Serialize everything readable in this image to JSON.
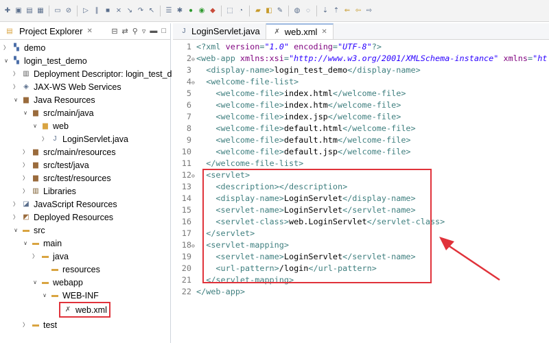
{
  "explorer": {
    "title": "Project Explorer",
    "items": [
      {
        "label": "demo",
        "icon": "project-icon",
        "expanded": false
      },
      {
        "label": "login_test_demo",
        "icon": "project-icon",
        "expanded": true
      },
      {
        "label": "Deployment Descriptor: login_test_d",
        "icon": "descriptor-icon"
      },
      {
        "label": "JAX-WS Web Services",
        "icon": "webservices-icon"
      },
      {
        "label": "Java Resources",
        "icon": "java-resources-icon",
        "expanded": true
      },
      {
        "label": "src/main/java",
        "icon": "source-folder-icon",
        "expanded": true
      },
      {
        "label": "web",
        "icon": "package-icon",
        "expanded": true
      },
      {
        "label": "LoginServlet.java",
        "icon": "java-file-icon"
      },
      {
        "label": "src/main/resources",
        "icon": "source-folder-icon"
      },
      {
        "label": "src/test/java",
        "icon": "source-folder-icon"
      },
      {
        "label": "src/test/resources",
        "icon": "source-folder-icon"
      },
      {
        "label": "Libraries",
        "icon": "library-icon"
      },
      {
        "label": "JavaScript Resources",
        "icon": "javascript-icon"
      },
      {
        "label": "Deployed Resources",
        "icon": "deployed-icon"
      },
      {
        "label": "src",
        "icon": "folder-icon",
        "expanded": true
      },
      {
        "label": "main",
        "icon": "folder-icon",
        "expanded": true
      },
      {
        "label": "java",
        "icon": "folder-icon"
      },
      {
        "label": "resources",
        "icon": "folder-icon"
      },
      {
        "label": "webapp",
        "icon": "folder-icon",
        "expanded": true
      },
      {
        "label": "WEB-INF",
        "icon": "folder-icon",
        "expanded": true
      },
      {
        "label": "web.xml",
        "icon": "xml-file-icon",
        "selected": true
      },
      {
        "label": "test",
        "icon": "folder-icon"
      }
    ]
  },
  "editor": {
    "tabs": [
      {
        "label": "LoginServlet.java",
        "active": false
      },
      {
        "label": "web.xml",
        "active": true
      }
    ],
    "lines": [
      {
        "n": "1",
        "fold": "",
        "code": "<?xml version=\"1.0\" encoding=\"UTF-8\"?>"
      },
      {
        "n": "2",
        "fold": "⊖",
        "code": "<web-app xmlns:xsi=\"http://www.w3.org/2001/XMLSchema-instance\" xmlns=\"ht"
      },
      {
        "n": "3",
        "fold": "",
        "code": "  <display-name>login_test_demo</display-name>"
      },
      {
        "n": "4",
        "fold": "⊖",
        "code": "  <welcome-file-list>"
      },
      {
        "n": "5",
        "fold": "",
        "code": "    <welcome-file>index.html</welcome-file>"
      },
      {
        "n": "6",
        "fold": "",
        "code": "    <welcome-file>index.htm</welcome-file>"
      },
      {
        "n": "7",
        "fold": "",
        "code": "    <welcome-file>index.jsp</welcome-file>"
      },
      {
        "n": "8",
        "fold": "",
        "code": "    <welcome-file>default.html</welcome-file>"
      },
      {
        "n": "9",
        "fold": "",
        "code": "    <welcome-file>default.htm</welcome-file>"
      },
      {
        "n": "10",
        "fold": "",
        "code": "    <welcome-file>default.jsp</welcome-file>"
      },
      {
        "n": "11",
        "fold": "",
        "code": "  </welcome-file-list>"
      },
      {
        "n": "12",
        "fold": "⊖",
        "code": "  <servlet>"
      },
      {
        "n": "13",
        "fold": "",
        "code": "    <description></description>"
      },
      {
        "n": "14",
        "fold": "",
        "code": "    <display-name>LoginServlet</display-name>"
      },
      {
        "n": "15",
        "fold": "",
        "code": "    <servlet-name>LoginServlet</servlet-name>"
      },
      {
        "n": "16",
        "fold": "",
        "code": "    <servlet-class>web.LoginServlet</servlet-class>"
      },
      {
        "n": "17",
        "fold": "",
        "code": "  </servlet>"
      },
      {
        "n": "18",
        "fold": "⊖",
        "code": "  <servlet-mapping>"
      },
      {
        "n": "19",
        "fold": "",
        "code": "    <servlet-name>LoginServlet</servlet-name>"
      },
      {
        "n": "20",
        "fold": "",
        "code": "    <url-pattern>/login</url-pattern>"
      },
      {
        "n": "21",
        "fold": "",
        "code": "  </servlet-mapping>"
      },
      {
        "n": "22",
        "fold": "",
        "code": "</web-app>"
      }
    ]
  },
  "colors": {
    "annotation": "#e0323a",
    "tag": "#3f7f7f",
    "attribute": "#7f007f",
    "string": "#2a00ff"
  }
}
